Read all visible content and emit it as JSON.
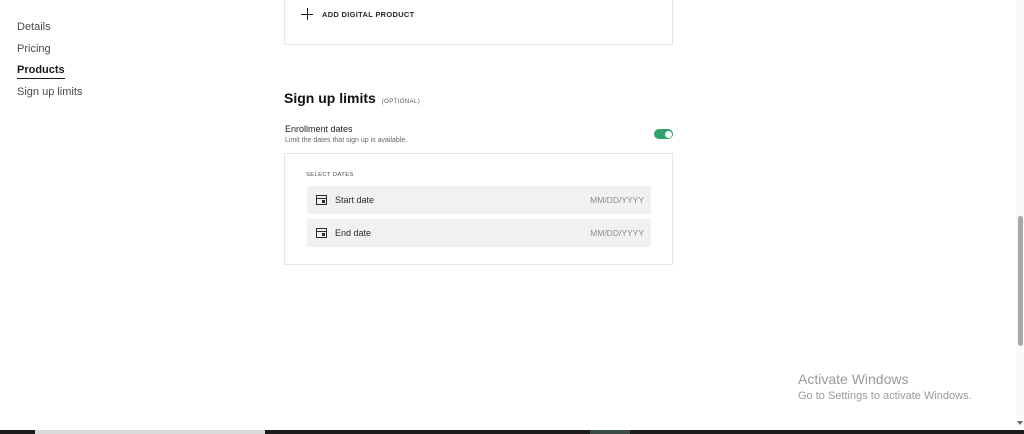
{
  "sidebar": {
    "items": [
      {
        "label": "Details"
      },
      {
        "label": "Pricing"
      },
      {
        "label": "Products",
        "active": true
      },
      {
        "label": "Sign up limits"
      }
    ]
  },
  "product_card": {
    "add_digital_label": "ADD DIGITAL PRODUCT"
  },
  "sign_up_limits": {
    "title": "Sign up limits",
    "optional_tag": "(OPTIONAL)",
    "enrollment_label": "Enrollment dates",
    "enrollment_desc": "Limit the dates that sign up is available.",
    "enrollment_enabled": true,
    "toggle_color": "#2fa46a",
    "select_dates_label": "SELECT DATES",
    "start_label": "Start date",
    "start_placeholder": "MM/DD/YYYY",
    "end_label": "End date",
    "end_placeholder": "MM/DD/YYYY"
  },
  "watermark": {
    "line1": "Activate Windows",
    "line2": "Go to Settings to activate Windows."
  },
  "icons": {
    "add": "plus-icon",
    "date": "calendar-icon"
  }
}
